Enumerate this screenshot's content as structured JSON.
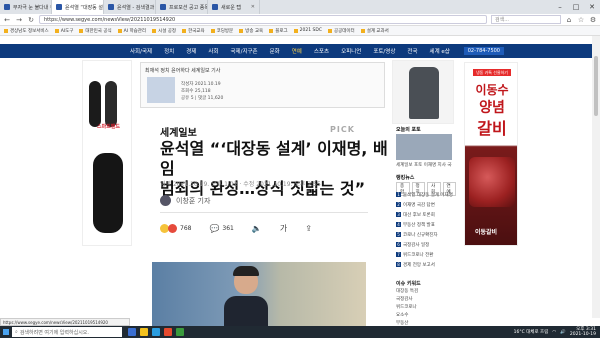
{
  "browser": {
    "tabs": [
      {
        "label": "무자극 눈 불다내 흰색화이",
        "active": false
      },
      {
        "label": "윤석열 “대장동 설계”",
        "active": true
      },
      {
        "label": "윤석열 - 검색결과",
        "active": false
      },
      {
        "label": "프로모션 공고 종목",
        "active": false
      },
      {
        "label": "새로운 탭",
        "active": false
      }
    ],
    "url": "https://www.segye.com/newsView/20211019514920",
    "search_placeholder": "검색...",
    "favorites": [
      "경상남도 정보서비스",
      "AI도구",
      "대한민국 공식",
      "AI 학습관리",
      "시설 공정",
      "한국교육",
      "코딩방문",
      "방송 교육",
      "블로그",
      "2021 SDC",
      "공공데이터",
      "설계 교과서"
    ]
  },
  "site": {
    "nav": [
      "사회/국제",
      "정치",
      "경제",
      "사회",
      "국제/지구촌",
      "문화",
      "연예",
      "스포츠",
      "오피니언",
      "포토/영상",
      "전국",
      "세계 e샵"
    ],
    "nav_highlight_index": 6,
    "tel": "02-784-7500"
  },
  "summary": {
    "title": "최재석 정치 윤어하다 세계일보 기사",
    "rows": [
      "작성자 2021.10.19",
      "조회수 25,118",
      "공유 5 | 댓글 11,620"
    ]
  },
  "article": {
    "brand": "세계일보",
    "pick": "PICK",
    "headline_line1": "윤석열 “‘대장동 설계’ 이재명, 배임",
    "headline_line2": "범죄의 완성…상식 짓밟는 것”",
    "dateline": "입력 2021.10.19. 오후 1:02 · 수정 2021.10.19. 오후 2:55",
    "author": "이창훈 기자",
    "reactions_count": "768",
    "comments_count": "361",
    "font_size_label": "가"
  },
  "right_column": {
    "section1_title": "오늘의 포토",
    "section1_caption": "세계일보 포토 이재명 지사 국감 출석",
    "section2_title": "랭킹뉴스",
    "section2_tabs": [
      "종합",
      "정치",
      "사회",
      "연예"
    ],
    "ranking": [
      "윤석열 대장동 설계 이재명",
      "이재명 국감 답변",
      "대선 후보 토론회",
      "부동산 정책 발표",
      "코로나 신규확진자",
      "국정감사 일정",
      "위드코로나 전환",
      "경제 전망 보고서"
    ],
    "section3_title": "이슈 키워드",
    "keywords": [
      "대장동 특검",
      "국정감사",
      "위드코로나",
      "요소수",
      "부동산"
    ]
  },
  "ad_right": {
    "badge": "냉동 카톡 선물하기",
    "line1": "이동수",
    "line2": "양념",
    "line3": "갈비",
    "brand": "이동갈비"
  },
  "ad_left": {
    "label": "스마트밴드"
  },
  "statusbar": {
    "url": "https://www.segye.com/newsView/20211019514920"
  },
  "taskbar": {
    "search_placeholder": "검색하려면 여기에 입력하십시오.",
    "weather": "16°C 대체로 흐림",
    "time": "오후 3:31",
    "date": "2021-10-19"
  }
}
